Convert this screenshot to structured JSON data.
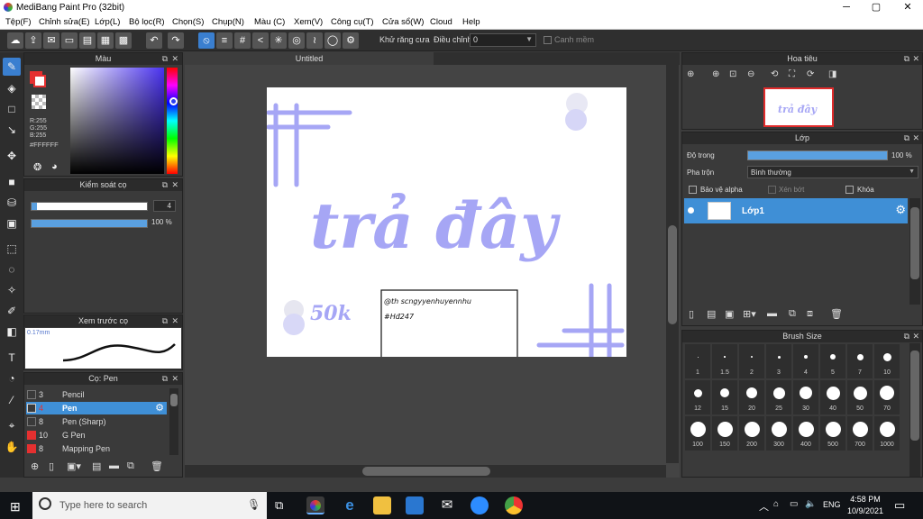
{
  "window": {
    "title": "MediBang Paint Pro (32bit)",
    "min": "─",
    "max": "▢",
    "close": "✕"
  },
  "menu": [
    "Tệp(F)",
    "Chỉnh sửa(E)",
    "Lớp(L)",
    "Bộ lọc(R)",
    "Chọn(S)",
    "Chụp(N)",
    "Màu (C)",
    "Xem(V)",
    "Công cụ(T)",
    "Cửa sổ(W)",
    "Cloud",
    "Help"
  ],
  "toolbar": {
    "antialias_label": "Khử răng cưa",
    "adjust_label": "Điều chỉnh",
    "adjust_value": "0",
    "snap_label": "Canh mềm"
  },
  "document": {
    "tab_title": "Untitled",
    "canvas_text": "trả đây",
    "small_text": "50k",
    "note_line1": "@th scngyyenhuyennhu",
    "note_line2": "#Hđ247"
  },
  "color_panel": {
    "title": "Màu",
    "r": "R:255",
    "g": "G:255",
    "b": "B:255",
    "hex": "#FFFFFF"
  },
  "brush_control": {
    "title": "Kiểm soát cọ",
    "size": "4",
    "opacity": "100 %"
  },
  "brush_preview": {
    "title": "Xem trước cọ",
    "size_label": "0.17mm"
  },
  "brush_list": {
    "title": "Cọ: Pen",
    "items": [
      {
        "size": "3",
        "name": "Pencil",
        "color": "#3a3a3a"
      },
      {
        "size": "4",
        "name": "Pen",
        "color": "#3a3a3a"
      },
      {
        "size": "8",
        "name": "Pen (Sharp)",
        "color": "#3a3a3a"
      },
      {
        "size": "10",
        "name": "G Pen",
        "color": "#e53030"
      },
      {
        "size": "8",
        "name": "Mapping Pen",
        "color": "#e53030"
      }
    ]
  },
  "navigator": {
    "title": "Hoa tiêu"
  },
  "layer_panel": {
    "title": "Lớp",
    "opacity_label": "Độ trong",
    "opacity_value": "100 %",
    "blend_label": "Pha trộn",
    "blend_value": "Bình thường",
    "protect_alpha": "Bảo vệ alpha",
    "clipping": "Xén bớt",
    "lock": "Khóa",
    "layer_name": "Lớp1"
  },
  "brush_size": {
    "title": "Brush Size",
    "sizes": [
      "1",
      "1.5",
      "2",
      "3",
      "4",
      "5",
      "7",
      "10",
      "12",
      "15",
      "20",
      "25",
      "30",
      "40",
      "50",
      "70",
      "100",
      "150",
      "200",
      "300",
      "400",
      "500",
      "700",
      "1000"
    ]
  },
  "taskbar": {
    "search_placeholder": "Type here to search",
    "time": "4:58 PM",
    "date": "10/9/2021",
    "lang": "ENG"
  },
  "colors": {
    "accent": "#3a7fd0",
    "drawing": "#a6a6f5",
    "layer_selected": "#3f8fd6"
  }
}
